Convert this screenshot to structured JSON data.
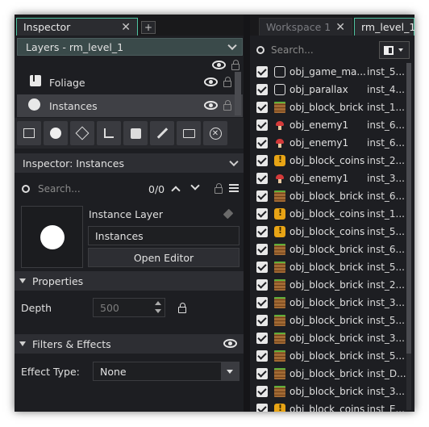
{
  "inspector": {
    "tab_label": "Inspector",
    "tab_close": "✕",
    "add_tab": "+",
    "layers_dropdown": "Layers - rm_level_1",
    "layers": [
      {
        "name": "Foliage"
      },
      {
        "name": "Instances"
      }
    ],
    "instances_panel_title": "Inspector: Instances",
    "search_placeholder": "Search...",
    "search_count": "0/0",
    "layer_type": "Instance Layer",
    "layer_name_value": "Instances",
    "open_editor": "Open Editor",
    "properties_header": "Properties",
    "depth_label": "Depth",
    "depth_value": "500",
    "filters_header": "Filters & Effects",
    "effect_type_label": "Effect Type:",
    "effect_type_value": "None"
  },
  "workspace": {
    "tabs": [
      {
        "label": "Workspace 1",
        "close": "✕"
      },
      {
        "label": "rm_level_1"
      }
    ],
    "search_placeholder": "Search...",
    "rows": [
      {
        "name": "obj_game_ma...",
        "inst": "inst_5...",
        "icon": "square-icon"
      },
      {
        "name": "obj_parallax",
        "inst": "inst_4...",
        "icon": "square-icon"
      },
      {
        "name": "obj_block_brick",
        "inst": "inst_1...",
        "icon": "brick-icon"
      },
      {
        "name": "obj_enemy1",
        "inst": "inst_6...",
        "icon": "enemy-icon"
      },
      {
        "name": "obj_enemy1",
        "inst": "inst_6...",
        "icon": "enemy-icon"
      },
      {
        "name": "obj_block_coins",
        "inst": "inst_2...",
        "icon": "coin-block-icon"
      },
      {
        "name": "obj_enemy1",
        "inst": "inst_3...",
        "icon": "enemy-icon"
      },
      {
        "name": "obj_block_brick",
        "inst": "inst_6...",
        "icon": "brick-icon"
      },
      {
        "name": "obj_block_coins",
        "inst": "inst_1...",
        "icon": "coin-block-icon"
      },
      {
        "name": "obj_block_coins",
        "inst": "inst_5...",
        "icon": "coin-block-icon"
      },
      {
        "name": "obj_block_brick",
        "inst": "inst_6...",
        "icon": "brick-icon"
      },
      {
        "name": "obj_block_brick",
        "inst": "inst_5...",
        "icon": "brick-icon"
      },
      {
        "name": "obj_block_brick",
        "inst": "inst_2...",
        "icon": "brick-icon"
      },
      {
        "name": "obj_block_brick",
        "inst": "inst_3...",
        "icon": "brick-icon"
      },
      {
        "name": "obj_block_brick",
        "inst": "inst_5...",
        "icon": "brick-icon"
      },
      {
        "name": "obj_block_brick",
        "inst": "inst_3...",
        "icon": "brick-icon"
      },
      {
        "name": "obj_block_brick",
        "inst": "inst_5...",
        "icon": "brick-icon"
      },
      {
        "name": "obj_block_brick",
        "inst": "inst_D...",
        "icon": "brick-icon"
      },
      {
        "name": "obj_block_brick",
        "inst": "inst_3...",
        "icon": "brick-icon"
      },
      {
        "name": "obj_block_coins",
        "inst": "inst_E...",
        "icon": "coin-block-icon"
      }
    ]
  },
  "colors": {
    "accent": "#4fc3a1",
    "background": "#1d1e22",
    "panel": "#2d2e33",
    "selected_row": "#3f4045"
  }
}
